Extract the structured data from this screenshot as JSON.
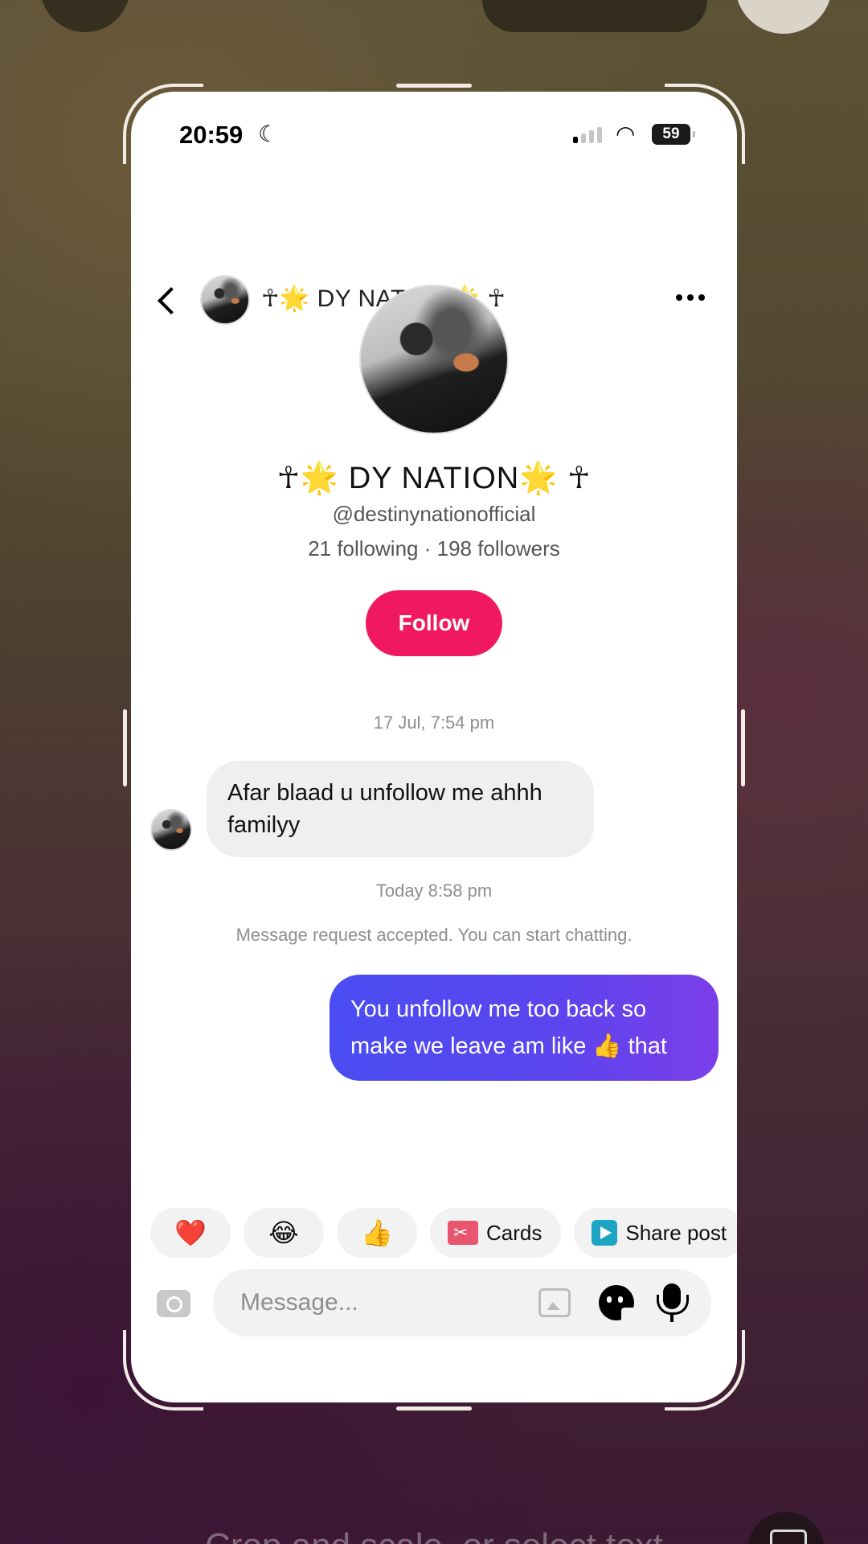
{
  "status_bar": {
    "time": "20:59",
    "moon_glyph": "☾",
    "wifi_glyph": "◠",
    "battery": "59"
  },
  "header": {
    "name": "☥🌟 DY NATION🌟 ☥"
  },
  "profile": {
    "name": "☥🌟 DY NATION🌟 ☥",
    "handle": "@destinynationofficial",
    "counts": "21 following · 198 followers",
    "follow_label": "Follow"
  },
  "thread": {
    "timestamp_1": "17 Jul, 7:54 pm",
    "incoming_message": "Afar blaad u unfollow me ahhh familyy",
    "timestamp_2": "Today 8:58 pm",
    "system_message": "Message request accepted. You can start chatting.",
    "outgoing_message": "You unfollow me too back so make we leave am like 👍 that"
  },
  "quick_replies": {
    "heart": "❤️",
    "laugh": "😂",
    "thumbs": "👍",
    "cards_label": "Cards",
    "share_label": "Share post"
  },
  "composer": {
    "placeholder": "Message..."
  },
  "editor": {
    "close_glyph": "✕",
    "hint": "Crop and scale, or select text"
  },
  "colors": {
    "follow_button": "#f0185e",
    "outgoing_bubble_start": "#4a4df2",
    "outgoing_bubble_end": "#7b3ee9",
    "incoming_bubble": "#efefef"
  },
  "icons": [
    "close-icon",
    "globe-icon",
    "frame-icon",
    "check-icon",
    "back-arrow-icon",
    "more-icon",
    "camera-icon",
    "gallery-icon",
    "sticker-icon",
    "microphone-icon",
    "gift-icon",
    "play-icon",
    "text-select-icon"
  ]
}
